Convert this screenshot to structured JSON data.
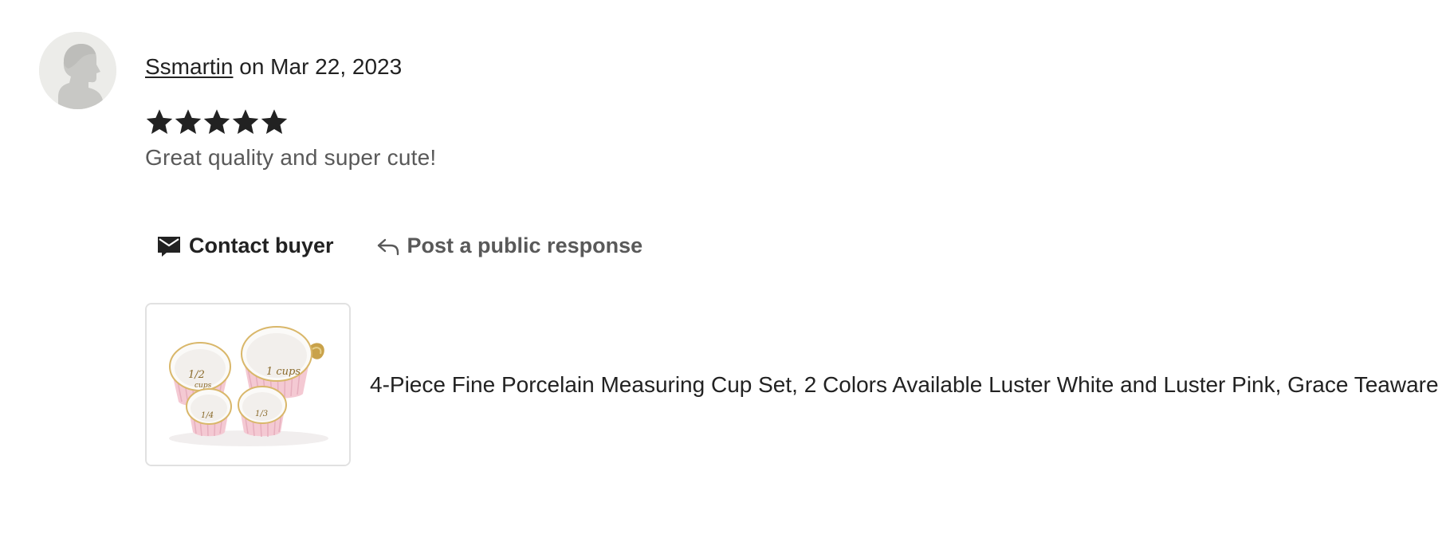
{
  "review": {
    "reviewer_name": "Ssmartin",
    "date_text": " on Mar 22, 2023",
    "rating": 5,
    "rating_max": 5,
    "text": "Great quality and super cute!"
  },
  "actions": {
    "contact_label": "Contact buyer",
    "public_response_label": "Post a public response"
  },
  "listing": {
    "title": "4-Piece Fine Porcelain Measuring Cup Set, 2 Colors Available Luster White and Luster Pink, Grace Teaware"
  },
  "icons": {
    "avatar": "default-user-silhouette-icon",
    "contact": "envelope-icon",
    "public_response": "reply-arrow-icon",
    "star": "star-icon"
  },
  "colors": {
    "primary_text": "#222222",
    "secondary_text": "#595959",
    "star": "#222222",
    "avatar_bg": "#ecece9"
  }
}
